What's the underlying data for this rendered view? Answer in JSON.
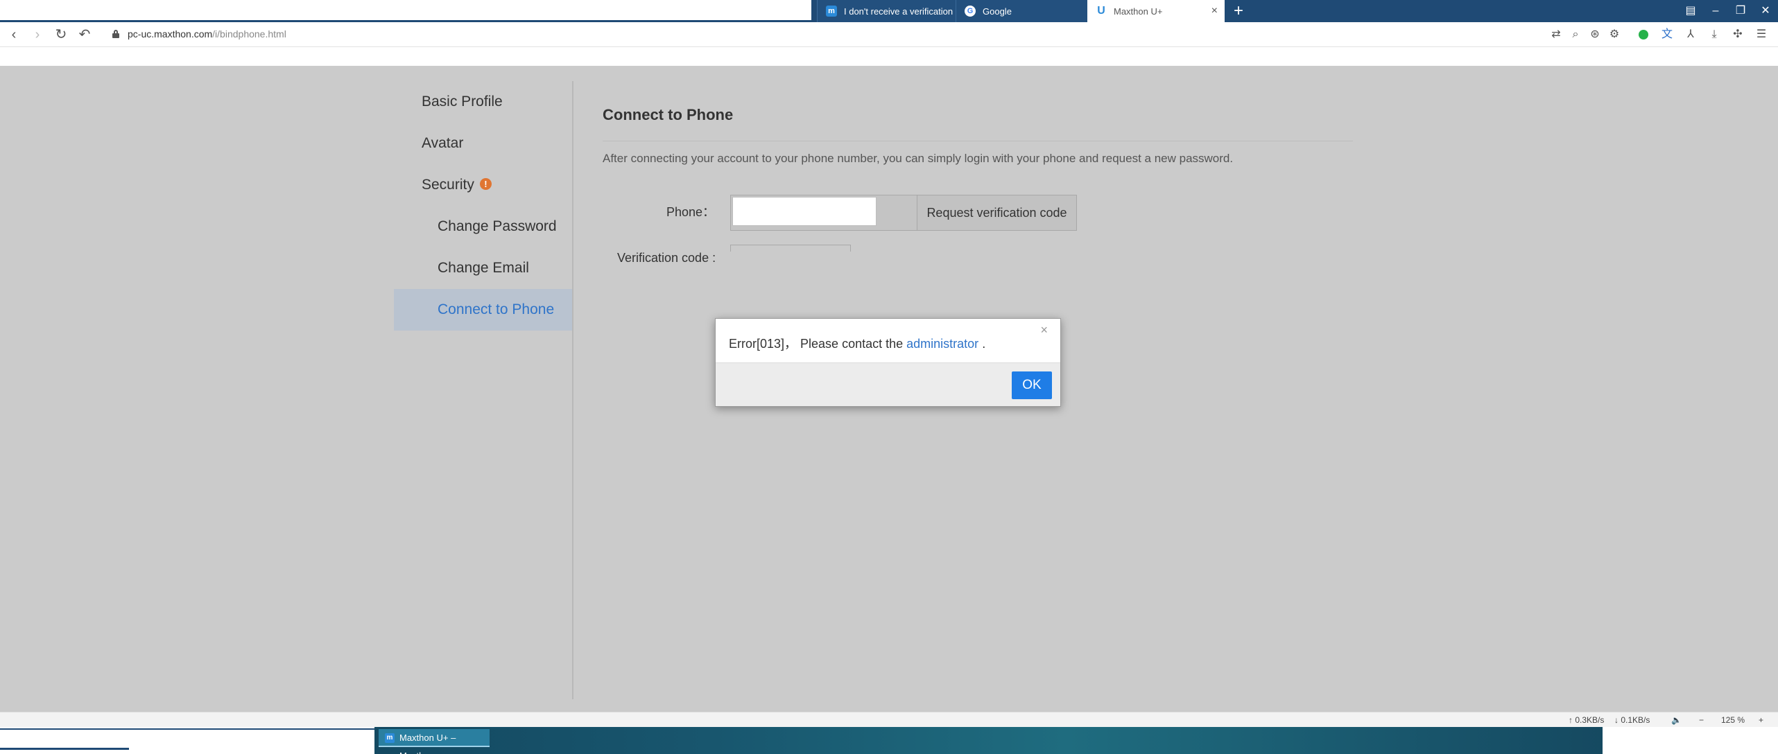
{
  "browser": {
    "tabs": [
      {
        "label": "I don't receive a verification",
        "icon": "maxthon-m-icon"
      },
      {
        "label": "Google",
        "icon": "google-icon"
      },
      {
        "label": "Maxthon U+",
        "icon": "maxthon-u-icon"
      }
    ],
    "url": {
      "host": "pc-uc.maxthon.com",
      "path": "/i/bindphone.html"
    }
  },
  "sidebar": {
    "items": [
      {
        "label": "Basic Profile"
      },
      {
        "label": "Avatar"
      },
      {
        "label": "Security"
      },
      {
        "label": "Change Password"
      },
      {
        "label": "Change Email"
      },
      {
        "label": "Connect to Phone"
      }
    ],
    "warning_glyph": "!"
  },
  "main": {
    "title": "Connect to Phone",
    "description": "After connecting your account to your phone number, you can simply login with your phone and request a new password.",
    "phone_label": "Phone：",
    "phone_value": "",
    "request_button": "Request verification code",
    "verification_label": "Verification code :"
  },
  "dialog": {
    "message_prefix": "Error[013]， Please contact the ",
    "link_text": "administrator",
    "message_suffix": " .",
    "close_glyph": "×",
    "ok_label": "OK"
  },
  "statusbar": {
    "upload": "↑ 0.3KB/s",
    "download": "↓ 0.1KB/s",
    "zoom": "125 %"
  },
  "taskbar": {
    "active_window": "Maxthon U+ – Maxth..."
  },
  "colors": {
    "accent": "#2f74c9",
    "ok_button": "#1f7de6",
    "warning": "#e07532",
    "tabbar": "#1f4a75"
  }
}
